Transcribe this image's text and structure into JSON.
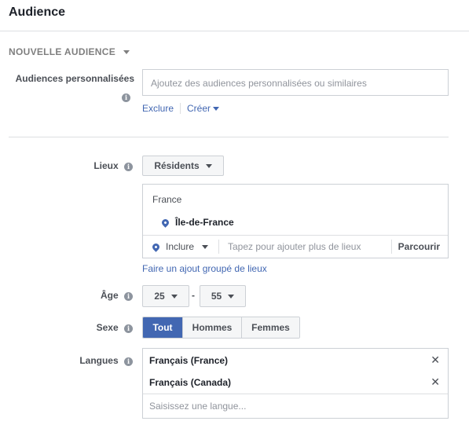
{
  "header": {
    "title": "Audience"
  },
  "audience_toggle": {
    "label": "NOUVELLE AUDIENCE"
  },
  "custom_audiences": {
    "label": "Audiences personnalisées",
    "placeholder": "Ajoutez des audiences personnalisées ou similaires",
    "exclude_label": "Exclure",
    "create_label": "Créer"
  },
  "locations": {
    "label": "Lieux",
    "type_button": "Résidents",
    "country": "France",
    "selected_location": "Île-de-France",
    "include_label": "Inclure",
    "search_placeholder": "Tapez pour ajouter plus de lieux",
    "browse_label": "Parcourir",
    "bulk_link": "Faire un ajout groupé de lieux"
  },
  "age": {
    "label": "Âge",
    "min": "25",
    "separator": "-",
    "max": "55"
  },
  "gender": {
    "label": "Sexe",
    "options": [
      "Tout",
      "Hommes",
      "Femmes"
    ],
    "selected": "Tout"
  },
  "languages": {
    "label": "Langues",
    "selected": [
      "Français (France)",
      "Français (Canada)"
    ],
    "placeholder": "Saisissez une langue...",
    "remove_glyph": "✕"
  },
  "icons": {
    "info": "i",
    "dropdown": "triangle-down-icon",
    "location": "map-pin-icon",
    "remove": "close-icon"
  },
  "colors": {
    "accent": "#4267b2",
    "text": "#1d2129",
    "muted": "#90949c",
    "border": "#ccd0d5"
  }
}
